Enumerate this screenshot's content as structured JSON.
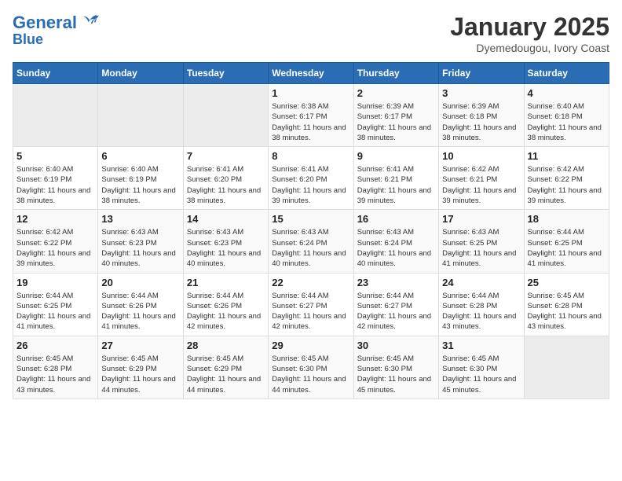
{
  "header": {
    "logo_line1": "General",
    "logo_line2": "Blue",
    "month": "January 2025",
    "location": "Dyemedougou, Ivory Coast"
  },
  "weekdays": [
    "Sunday",
    "Monday",
    "Tuesday",
    "Wednesday",
    "Thursday",
    "Friday",
    "Saturday"
  ],
  "weeks": [
    [
      {
        "day": "",
        "sunrise": "",
        "sunset": "",
        "daylight": ""
      },
      {
        "day": "",
        "sunrise": "",
        "sunset": "",
        "daylight": ""
      },
      {
        "day": "",
        "sunrise": "",
        "sunset": "",
        "daylight": ""
      },
      {
        "day": "1",
        "sunrise": "Sunrise: 6:38 AM",
        "sunset": "Sunset: 6:17 PM",
        "daylight": "Daylight: 11 hours and 38 minutes."
      },
      {
        "day": "2",
        "sunrise": "Sunrise: 6:39 AM",
        "sunset": "Sunset: 6:17 PM",
        "daylight": "Daylight: 11 hours and 38 minutes."
      },
      {
        "day": "3",
        "sunrise": "Sunrise: 6:39 AM",
        "sunset": "Sunset: 6:18 PM",
        "daylight": "Daylight: 11 hours and 38 minutes."
      },
      {
        "day": "4",
        "sunrise": "Sunrise: 6:40 AM",
        "sunset": "Sunset: 6:18 PM",
        "daylight": "Daylight: 11 hours and 38 minutes."
      }
    ],
    [
      {
        "day": "5",
        "sunrise": "Sunrise: 6:40 AM",
        "sunset": "Sunset: 6:19 PM",
        "daylight": "Daylight: 11 hours and 38 minutes."
      },
      {
        "day": "6",
        "sunrise": "Sunrise: 6:40 AM",
        "sunset": "Sunset: 6:19 PM",
        "daylight": "Daylight: 11 hours and 38 minutes."
      },
      {
        "day": "7",
        "sunrise": "Sunrise: 6:41 AM",
        "sunset": "Sunset: 6:20 PM",
        "daylight": "Daylight: 11 hours and 38 minutes."
      },
      {
        "day": "8",
        "sunrise": "Sunrise: 6:41 AM",
        "sunset": "Sunset: 6:20 PM",
        "daylight": "Daylight: 11 hours and 39 minutes."
      },
      {
        "day": "9",
        "sunrise": "Sunrise: 6:41 AM",
        "sunset": "Sunset: 6:21 PM",
        "daylight": "Daylight: 11 hours and 39 minutes."
      },
      {
        "day": "10",
        "sunrise": "Sunrise: 6:42 AM",
        "sunset": "Sunset: 6:21 PM",
        "daylight": "Daylight: 11 hours and 39 minutes."
      },
      {
        "day": "11",
        "sunrise": "Sunrise: 6:42 AM",
        "sunset": "Sunset: 6:22 PM",
        "daylight": "Daylight: 11 hours and 39 minutes."
      }
    ],
    [
      {
        "day": "12",
        "sunrise": "Sunrise: 6:42 AM",
        "sunset": "Sunset: 6:22 PM",
        "daylight": "Daylight: 11 hours and 39 minutes."
      },
      {
        "day": "13",
        "sunrise": "Sunrise: 6:43 AM",
        "sunset": "Sunset: 6:23 PM",
        "daylight": "Daylight: 11 hours and 40 minutes."
      },
      {
        "day": "14",
        "sunrise": "Sunrise: 6:43 AM",
        "sunset": "Sunset: 6:23 PM",
        "daylight": "Daylight: 11 hours and 40 minutes."
      },
      {
        "day": "15",
        "sunrise": "Sunrise: 6:43 AM",
        "sunset": "Sunset: 6:24 PM",
        "daylight": "Daylight: 11 hours and 40 minutes."
      },
      {
        "day": "16",
        "sunrise": "Sunrise: 6:43 AM",
        "sunset": "Sunset: 6:24 PM",
        "daylight": "Daylight: 11 hours and 40 minutes."
      },
      {
        "day": "17",
        "sunrise": "Sunrise: 6:43 AM",
        "sunset": "Sunset: 6:25 PM",
        "daylight": "Daylight: 11 hours and 41 minutes."
      },
      {
        "day": "18",
        "sunrise": "Sunrise: 6:44 AM",
        "sunset": "Sunset: 6:25 PM",
        "daylight": "Daylight: 11 hours and 41 minutes."
      }
    ],
    [
      {
        "day": "19",
        "sunrise": "Sunrise: 6:44 AM",
        "sunset": "Sunset: 6:25 PM",
        "daylight": "Daylight: 11 hours and 41 minutes."
      },
      {
        "day": "20",
        "sunrise": "Sunrise: 6:44 AM",
        "sunset": "Sunset: 6:26 PM",
        "daylight": "Daylight: 11 hours and 41 minutes."
      },
      {
        "day": "21",
        "sunrise": "Sunrise: 6:44 AM",
        "sunset": "Sunset: 6:26 PM",
        "daylight": "Daylight: 11 hours and 42 minutes."
      },
      {
        "day": "22",
        "sunrise": "Sunrise: 6:44 AM",
        "sunset": "Sunset: 6:27 PM",
        "daylight": "Daylight: 11 hours and 42 minutes."
      },
      {
        "day": "23",
        "sunrise": "Sunrise: 6:44 AM",
        "sunset": "Sunset: 6:27 PM",
        "daylight": "Daylight: 11 hours and 42 minutes."
      },
      {
        "day": "24",
        "sunrise": "Sunrise: 6:44 AM",
        "sunset": "Sunset: 6:28 PM",
        "daylight": "Daylight: 11 hours and 43 minutes."
      },
      {
        "day": "25",
        "sunrise": "Sunrise: 6:45 AM",
        "sunset": "Sunset: 6:28 PM",
        "daylight": "Daylight: 11 hours and 43 minutes."
      }
    ],
    [
      {
        "day": "26",
        "sunrise": "Sunrise: 6:45 AM",
        "sunset": "Sunset: 6:28 PM",
        "daylight": "Daylight: 11 hours and 43 minutes."
      },
      {
        "day": "27",
        "sunrise": "Sunrise: 6:45 AM",
        "sunset": "Sunset: 6:29 PM",
        "daylight": "Daylight: 11 hours and 44 minutes."
      },
      {
        "day": "28",
        "sunrise": "Sunrise: 6:45 AM",
        "sunset": "Sunset: 6:29 PM",
        "daylight": "Daylight: 11 hours and 44 minutes."
      },
      {
        "day": "29",
        "sunrise": "Sunrise: 6:45 AM",
        "sunset": "Sunset: 6:30 PM",
        "daylight": "Daylight: 11 hours and 44 minutes."
      },
      {
        "day": "30",
        "sunrise": "Sunrise: 6:45 AM",
        "sunset": "Sunset: 6:30 PM",
        "daylight": "Daylight: 11 hours and 45 minutes."
      },
      {
        "day": "31",
        "sunrise": "Sunrise: 6:45 AM",
        "sunset": "Sunset: 6:30 PM",
        "daylight": "Daylight: 11 hours and 45 minutes."
      },
      {
        "day": "",
        "sunrise": "",
        "sunset": "",
        "daylight": ""
      }
    ]
  ]
}
